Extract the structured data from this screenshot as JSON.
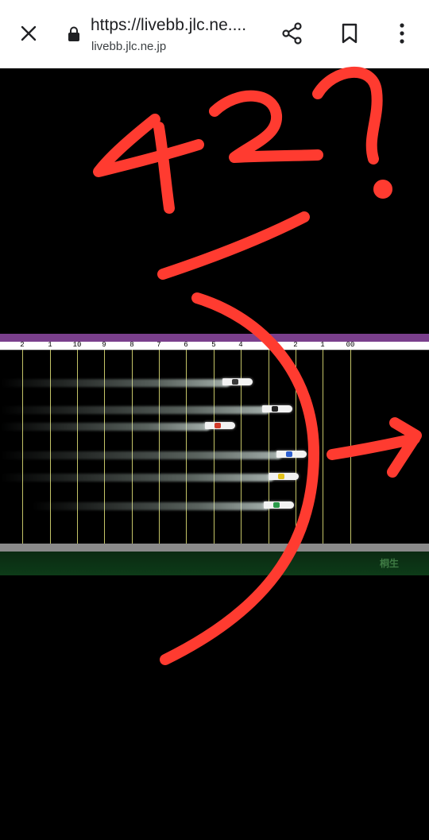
{
  "browser": {
    "url_title": "https://livebb.jlc.ne....",
    "url_domain": "livebb.jlc.ne.jp",
    "close_icon": "close-icon",
    "lock_icon": "lock-icon",
    "share_icon": "share-icon",
    "bookmark_icon": "bookmark-icon",
    "menu_icon": "more-vert-icon"
  },
  "race_view": {
    "distance_markers": [
      "2",
      "1",
      "10",
      "9",
      "8",
      "7",
      "6",
      "5",
      "4",
      "3",
      "2",
      "1",
      "00"
    ],
    "watermark": "桐生",
    "colors": {
      "top_bar": "#7a3f8c",
      "lines": "#e6e67a",
      "grass": "#0d3b18"
    }
  },
  "annotation": {
    "handwritten_text": "42?",
    "color": "#ff3b30"
  }
}
